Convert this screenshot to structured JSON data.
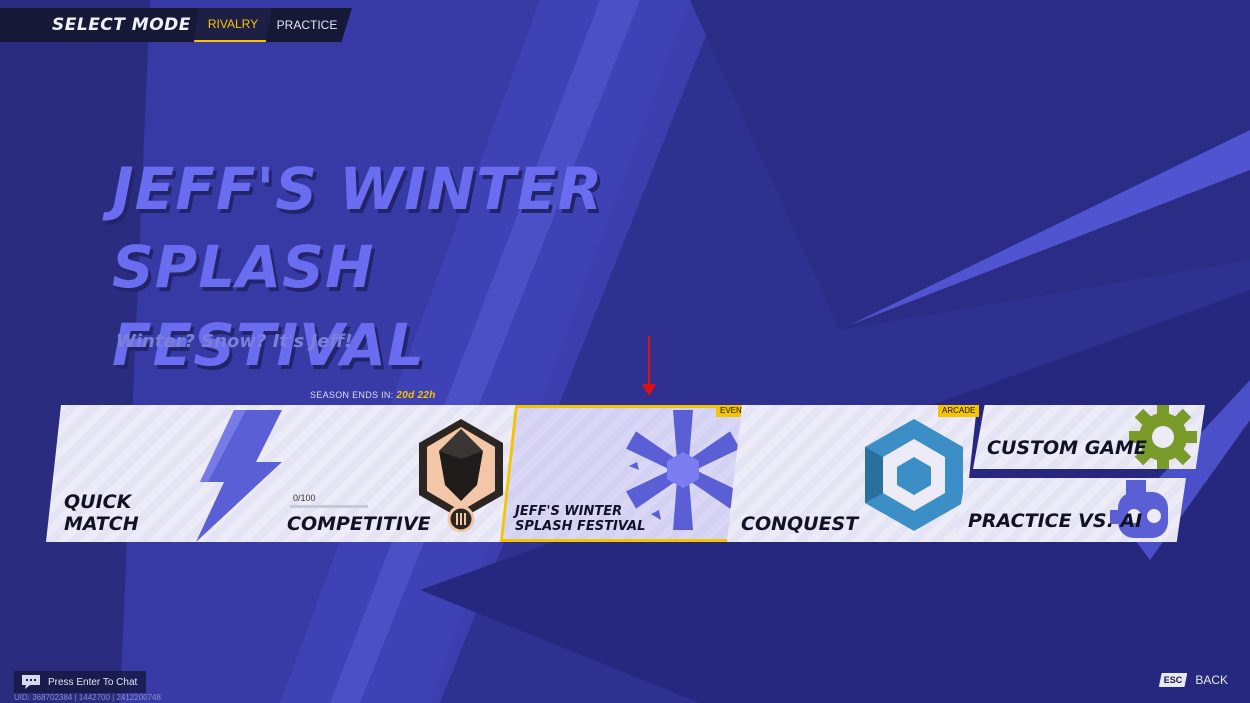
{
  "header": {
    "select_mode": "SELECT MODE",
    "tabs": [
      {
        "label": "RIVALRY",
        "active": true
      },
      {
        "label": "PRACTICE",
        "active": false
      }
    ]
  },
  "hero": {
    "title_line1": "JEFF'S WINTER SPLASH",
    "title_line2": "FESTIVAL",
    "subtitle": "Winter? Snow? It's Jeff!"
  },
  "season": {
    "label": "SEASON ENDS IN:",
    "time": "20d 22h"
  },
  "modes": {
    "quick_match": {
      "line1": "QUICK",
      "line2": "MATCH"
    },
    "competitive": {
      "label": "COMPETITIVE",
      "progress_text": "0/100",
      "progress": 0
    },
    "event": {
      "line1": "JEFF'S WINTER",
      "line2": "SPLASH FESTIVAL",
      "badge": "EVENT"
    },
    "conquest": {
      "label": "CONQUEST",
      "badge": "ARCADE"
    },
    "custom_game": {
      "label": "CUSTOM GAME"
    },
    "practice_ai": {
      "label": "PRACTICE VS. AI"
    }
  },
  "footer": {
    "chat_hint": "Press Enter To Chat",
    "uid": "UID: 368702384 | 1442700 | 2412200748",
    "esc_key": "ESC",
    "back_label": "BACK"
  },
  "colors": {
    "background": "#2f3190",
    "accent": "#f5c400",
    "title": "#6a6df0",
    "card": "#ecebf7",
    "icon_blue": "#5b5fd6",
    "icon_green": "#7a9a2a",
    "icon_teal": "#3b8fc6"
  },
  "icons": [
    "lightning-icon",
    "rank-emblem-icon",
    "snowflake-icon",
    "conquest-icon",
    "gear-icon",
    "robot-icon",
    "chat-icon"
  ]
}
